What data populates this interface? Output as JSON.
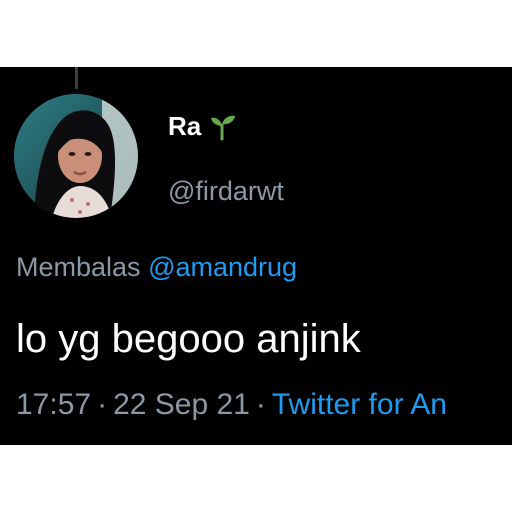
{
  "tweet": {
    "display_name": "Ra",
    "handle": "@firdarwt",
    "reply_prefix": "Membalas",
    "reply_mention": "@amandrug",
    "text": "lo yg begooo anjink",
    "time": "17:57",
    "date": "22 Sep 21",
    "separator": "·",
    "source": "Twitter for An",
    "name_icon": "sprout-icon",
    "avatar_icon": "avatar-photo"
  },
  "colors": {
    "background": "#000000",
    "text_primary": "#ffffff",
    "text_secondary": "#8b98a5",
    "accent": "#1d9bf0",
    "sprout": "#6aa84f"
  }
}
